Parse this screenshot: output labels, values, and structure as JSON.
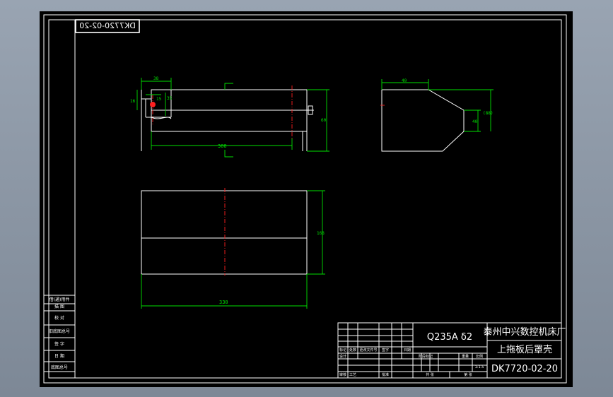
{
  "drawing": {
    "stamp_number": "DK7720-02-20",
    "material_spec": "Q235A δ2",
    "company": "泰州中兴数控机床厂",
    "part_name": "上拖板后罩壳",
    "drawing_number": "DK7720-02-20",
    "scale": "1:1.5"
  },
  "side_table": {
    "rows": [
      "借(通)用件",
      "旧底图总号",
      "签 字",
      "日 期"
    ],
    "extra": [
      "描 图",
      "校 对",
      "底图总号"
    ]
  },
  "title_block": {
    "revision_headers": [
      "标记",
      "处数",
      "更改文件号",
      "签字",
      "日期"
    ],
    "sign_rows": [
      "设计",
      "审核",
      "工艺",
      "批准"
    ],
    "columns": [
      "阶段标记",
      "重量",
      "比例"
    ],
    "footer": [
      "共 张",
      "第 张"
    ]
  },
  "dimensions": {
    "front_top_width": "38",
    "front_left_height": "16",
    "front_hole": "15",
    "front_mid": "35",
    "front_length": "300",
    "front_height": "60",
    "side_top": "40",
    "side_height": "40",
    "side_ref": "(88)",
    "plan_height": "168",
    "plan_length": "330"
  }
}
